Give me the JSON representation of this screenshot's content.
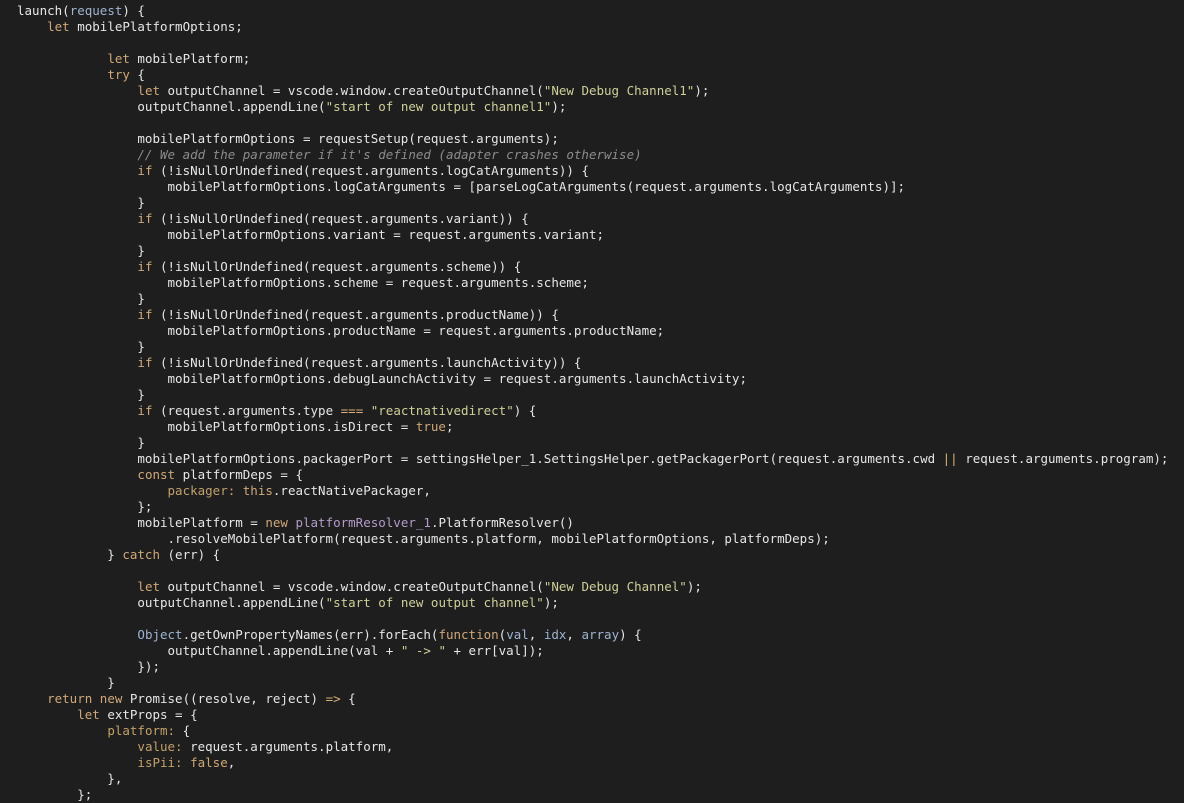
{
  "editor": {
    "language": "javascript",
    "colors": {
      "background": "#1e1e1e",
      "plain": "#e6e6e6",
      "keyword": "#cfa87a",
      "string": "#cfcf9a",
      "comment": "#8c8c8c",
      "parameter": "#9fb4d0",
      "class": "#b49bc9",
      "property": "#c2a06a"
    },
    "lines": [
      [
        {
          "t": "launch(",
          "k": "p"
        },
        {
          "t": "request",
          "k": "prm"
        },
        {
          "t": ") {",
          "k": "p"
        }
      ],
      [
        {
          "t": "    ",
          "k": "p"
        },
        {
          "t": "let",
          "k": "k"
        },
        {
          "t": " mobilePlatformOptions;",
          "k": "p"
        }
      ],
      [],
      [
        {
          "t": "            ",
          "k": "p"
        },
        {
          "t": "let",
          "k": "k"
        },
        {
          "t": " mobilePlatform;",
          "k": "p"
        }
      ],
      [
        {
          "t": "            ",
          "k": "p"
        },
        {
          "t": "try",
          "k": "k"
        },
        {
          "t": " {",
          "k": "p"
        }
      ],
      [
        {
          "t": "                ",
          "k": "p"
        },
        {
          "t": "let",
          "k": "k"
        },
        {
          "t": " outputChannel = vscode.window.createOutputChannel(",
          "k": "p"
        },
        {
          "t": "\"New Debug Channel1\"",
          "k": "s"
        },
        {
          "t": ");",
          "k": "p"
        }
      ],
      [
        {
          "t": "                outputChannel.appendLine(",
          "k": "p"
        },
        {
          "t": "\"start of new output channel1\"",
          "k": "s"
        },
        {
          "t": ");",
          "k": "p"
        }
      ],
      [],
      [
        {
          "t": "                mobilePlatformOptions = requestSetup(request.arguments);",
          "k": "p"
        }
      ],
      [
        {
          "t": "                // We add the parameter if it's defined (adapter crashes otherwise)",
          "k": "c"
        }
      ],
      [
        {
          "t": "                ",
          "k": "p"
        },
        {
          "t": "if",
          "k": "k"
        },
        {
          "t": " (!isNullOrUndefined(request.arguments.logCatArguments)) {",
          "k": "p"
        }
      ],
      [
        {
          "t": "                    mobilePlatformOptions.logCatArguments = [parseLogCatArguments(request.arguments.logCatArguments)];",
          "k": "p"
        }
      ],
      [
        {
          "t": "                }",
          "k": "p"
        }
      ],
      [
        {
          "t": "                ",
          "k": "p"
        },
        {
          "t": "if",
          "k": "k"
        },
        {
          "t": " (!isNullOrUndefined(request.arguments.variant)) {",
          "k": "p"
        }
      ],
      [
        {
          "t": "                    mobilePlatformOptions.variant = request.arguments.variant;",
          "k": "p"
        }
      ],
      [
        {
          "t": "                }",
          "k": "p"
        }
      ],
      [
        {
          "t": "                ",
          "k": "p"
        },
        {
          "t": "if",
          "k": "k"
        },
        {
          "t": " (!isNullOrUndefined(request.arguments.scheme)) {",
          "k": "p"
        }
      ],
      [
        {
          "t": "                    mobilePlatformOptions.scheme = request.arguments.scheme;",
          "k": "p"
        }
      ],
      [
        {
          "t": "                }",
          "k": "p"
        }
      ],
      [
        {
          "t": "                ",
          "k": "p"
        },
        {
          "t": "if",
          "k": "k"
        },
        {
          "t": " (!isNullOrUndefined(request.arguments.productName)) {",
          "k": "p"
        }
      ],
      [
        {
          "t": "                    mobilePlatformOptions.productName = request.arguments.productName;",
          "k": "p"
        }
      ],
      [
        {
          "t": "                }",
          "k": "p"
        }
      ],
      [
        {
          "t": "                ",
          "k": "p"
        },
        {
          "t": "if",
          "k": "k"
        },
        {
          "t": " (!isNullOrUndefined(request.arguments.launchActivity)) {",
          "k": "p"
        }
      ],
      [
        {
          "t": "                    mobilePlatformOptions.debugLaunchActivity = request.arguments.launchActivity;",
          "k": "p"
        }
      ],
      [
        {
          "t": "                }",
          "k": "p"
        }
      ],
      [
        {
          "t": "                ",
          "k": "p"
        },
        {
          "t": "if",
          "k": "k"
        },
        {
          "t": " (request.arguments.type ",
          "k": "p"
        },
        {
          "t": "===",
          "k": "op"
        },
        {
          "t": " ",
          "k": "p"
        },
        {
          "t": "\"reactnativedirect\"",
          "k": "s"
        },
        {
          "t": ") {",
          "k": "p"
        }
      ],
      [
        {
          "t": "                    mobilePlatformOptions.isDirect = ",
          "k": "p"
        },
        {
          "t": "true",
          "k": "k"
        },
        {
          "t": ";",
          "k": "p"
        }
      ],
      [
        {
          "t": "                }",
          "k": "p"
        }
      ],
      [
        {
          "t": "                mobilePlatformOptions.packagerPort = settingsHelper_1.SettingsHelper.getPackagerPort(request.arguments.cwd ",
          "k": "p"
        },
        {
          "t": "||",
          "k": "op"
        },
        {
          "t": " request.arguments.program);",
          "k": "p"
        }
      ],
      [
        {
          "t": "                ",
          "k": "p"
        },
        {
          "t": "const",
          "k": "k"
        },
        {
          "t": " platformDeps = {",
          "k": "p"
        }
      ],
      [
        {
          "t": "                    ",
          "k": "p"
        },
        {
          "t": "packager:",
          "k": "pr"
        },
        {
          "t": " ",
          "k": "p"
        },
        {
          "t": "this",
          "k": "k"
        },
        {
          "t": ".reactNativePackager,",
          "k": "p"
        }
      ],
      [
        {
          "t": "                };",
          "k": "p"
        }
      ],
      [
        {
          "t": "                mobilePlatform = ",
          "k": "p"
        },
        {
          "t": "new",
          "k": "k"
        },
        {
          "t": " ",
          "k": "p"
        },
        {
          "t": "platformResolver_1",
          "k": "cls"
        },
        {
          "t": ".PlatformResolver()",
          "k": "p"
        }
      ],
      [
        {
          "t": "                    .resolveMobilePlatform(request.arguments.platform, mobilePlatformOptions, platformDeps);",
          "k": "p"
        }
      ],
      [
        {
          "t": "            } ",
          "k": "p"
        },
        {
          "t": "catch",
          "k": "k"
        },
        {
          "t": " (err) {",
          "k": "p"
        }
      ],
      [],
      [
        {
          "t": "                ",
          "k": "p"
        },
        {
          "t": "let",
          "k": "k"
        },
        {
          "t": " outputChannel = vscode.window.createOutputChannel(",
          "k": "p"
        },
        {
          "t": "\"New Debug Channel\"",
          "k": "s"
        },
        {
          "t": ");",
          "k": "p"
        }
      ],
      [
        {
          "t": "                outputChannel.appendLine(",
          "k": "p"
        },
        {
          "t": "\"start of new output channel\"",
          "k": "s"
        },
        {
          "t": ");",
          "k": "p"
        }
      ],
      [],
      [
        {
          "t": "                ",
          "k": "p"
        },
        {
          "t": "Object",
          "k": "prm"
        },
        {
          "t": ".getOwnPropertyNames(err).forEach(",
          "k": "p"
        },
        {
          "t": "function",
          "k": "k"
        },
        {
          "t": "(",
          "k": "p"
        },
        {
          "t": "val",
          "k": "prm"
        },
        {
          "t": ", ",
          "k": "p"
        },
        {
          "t": "idx",
          "k": "prm"
        },
        {
          "t": ", ",
          "k": "p"
        },
        {
          "t": "array",
          "k": "prm"
        },
        {
          "t": ") {",
          "k": "p"
        }
      ],
      [
        {
          "t": "                    outputChannel.appendLine(val + ",
          "k": "p"
        },
        {
          "t": "\" -> \"",
          "k": "s"
        },
        {
          "t": " + err[val]);",
          "k": "p"
        }
      ],
      [
        {
          "t": "                });",
          "k": "p"
        }
      ],
      [
        {
          "t": "            }",
          "k": "p"
        }
      ],
      [
        {
          "t": "    ",
          "k": "p"
        },
        {
          "t": "return",
          "k": "k"
        },
        {
          "t": " ",
          "k": "p"
        },
        {
          "t": "new",
          "k": "k"
        },
        {
          "t": " Promise((resolve, reject) ",
          "k": "p"
        },
        {
          "t": "=>",
          "k": "op"
        },
        {
          "t": " {",
          "k": "p"
        }
      ],
      [
        {
          "t": "        ",
          "k": "p"
        },
        {
          "t": "let",
          "k": "k"
        },
        {
          "t": " extProps = {",
          "k": "p"
        }
      ],
      [
        {
          "t": "            ",
          "k": "p"
        },
        {
          "t": "platform:",
          "k": "pr"
        },
        {
          "t": " {",
          "k": "p"
        }
      ],
      [
        {
          "t": "                ",
          "k": "p"
        },
        {
          "t": "value:",
          "k": "pr"
        },
        {
          "t": " request.arguments.platform,",
          "k": "p"
        }
      ],
      [
        {
          "t": "                ",
          "k": "p"
        },
        {
          "t": "isPii:",
          "k": "pr"
        },
        {
          "t": " ",
          "k": "p"
        },
        {
          "t": "false",
          "k": "k"
        },
        {
          "t": ",",
          "k": "p"
        }
      ],
      [
        {
          "t": "            },",
          "k": "p"
        }
      ],
      [
        {
          "t": "        };",
          "k": "p"
        }
      ]
    ]
  }
}
